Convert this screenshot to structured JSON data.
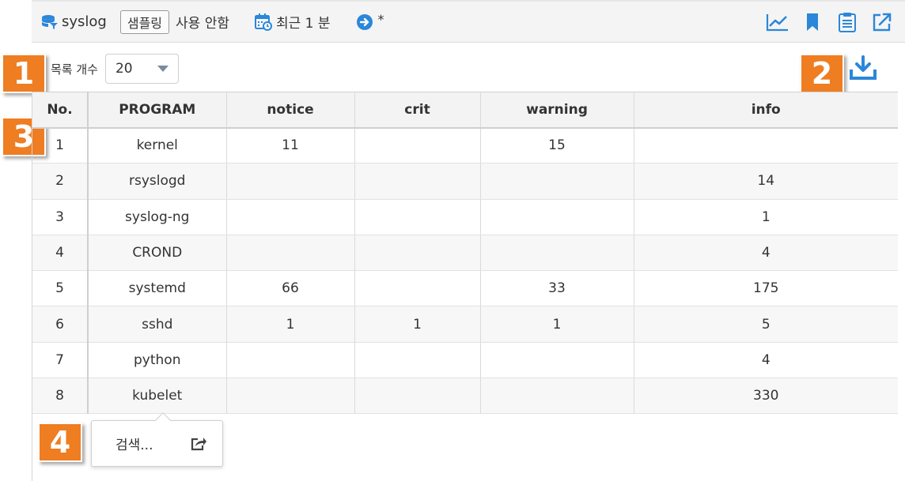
{
  "toolbar": {
    "source_label": "syslog",
    "sampling_badge": "샘플링",
    "sampling_state": "사용 안함",
    "time_range": "최근 1 분",
    "query_marker": "*",
    "icons": [
      "chart-icon",
      "bookmark-icon",
      "clipboard-icon",
      "export-icon"
    ]
  },
  "callouts": [
    "1",
    "2",
    "3",
    "4"
  ],
  "list_count": {
    "label": "목록 개수",
    "selected": "20"
  },
  "table": {
    "columns": [
      "No.",
      "PROGRAM",
      "notice",
      "crit",
      "warning",
      "info"
    ],
    "rows": [
      [
        "1",
        "kernel",
        "11",
        "",
        "15",
        ""
      ],
      [
        "2",
        "rsyslogd",
        "",
        "",
        "",
        "14"
      ],
      [
        "3",
        "syslog-ng",
        "",
        "",
        "",
        "1"
      ],
      [
        "4",
        "CROND",
        "",
        "",
        "",
        "4"
      ],
      [
        "5",
        "systemd",
        "66",
        "",
        "33",
        "175"
      ],
      [
        "6",
        "sshd",
        "1",
        "1",
        "1",
        "5"
      ],
      [
        "7",
        "python",
        "",
        "",
        "",
        "4"
      ],
      [
        "8",
        "kubelet",
        "",
        "",
        "",
        "330"
      ]
    ]
  },
  "popup": {
    "label": "검색..."
  },
  "colors": {
    "accent_blue": "#2b87d9",
    "callout_orange": "#ef7d22"
  }
}
